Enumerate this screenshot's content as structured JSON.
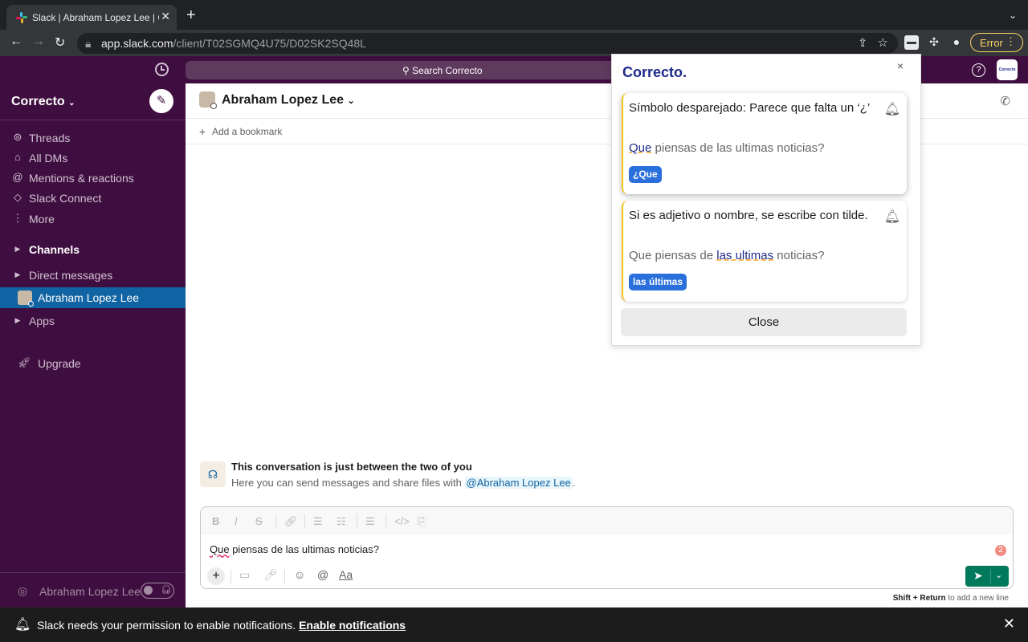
{
  "browser": {
    "tab_title": "Slack | Abraham Lopez Lee | Correcto",
    "tab_close": "✕",
    "new_tab": "+",
    "url_host": "app.slack.com",
    "url_path": "/client/T02SGMQ4U75/D02SK2SQ48L",
    "error_label": "Error"
  },
  "slack_top": {
    "search_placeholder": "Search Correcto",
    "help": "?",
    "workspace_avatar_text": "Correcto"
  },
  "sidebar": {
    "workspace": "Correcto",
    "items": [
      {
        "label": "Threads",
        "icon": "threads-icon"
      },
      {
        "label": "All DMs",
        "icon": "dms-icon"
      },
      {
        "label": "Mentions & reactions",
        "icon": "mention-icon"
      },
      {
        "label": "Slack Connect",
        "icon": "connect-icon"
      },
      {
        "label": "More",
        "icon": "more-icon"
      },
      {
        "label": "Channels",
        "icon": "caret-icon"
      },
      {
        "label": "Direct messages",
        "icon": "caret-icon"
      },
      {
        "label": "Apps",
        "icon": "caret-icon"
      },
      {
        "label": "Upgrade",
        "icon": "rocket-icon"
      }
    ],
    "active_dm": "Abraham Lopez Lee",
    "footer_user": "Abraham Lopez Lee"
  },
  "channel": {
    "name": "Abraham Lopez Lee",
    "add_bookmark": "Add a bookmark",
    "intro_title": "This conversation is just between the two of you",
    "intro_text": "Here you can send messages and share files with ",
    "intro_mention": "@Abraham Lopez Lee",
    "intro_end": "."
  },
  "composer": {
    "message_err": "Que",
    "message_rest": " piensas de las ultimas noticias?",
    "error_count": "2",
    "hint_keys": "Shift + Return",
    "hint_text": " to add a new line"
  },
  "notification": {
    "text": "Slack needs your permission to enable notifications. ",
    "link": "Enable notifications"
  },
  "correcto": {
    "logo": "Correcto.",
    "close_x": "×",
    "cards": [
      {
        "title": "Símbolo desparejado: Parece que falta un ‘¿’",
        "sentence_pre": "",
        "sentence_hl": "Que",
        "sentence_post": " piensas de las ultimas noticias?",
        "suggestion": "¿Que"
      },
      {
        "title": "Si es adjetivo o nombre, se escribe con tilde.",
        "sentence_pre": "Que piensas de ",
        "sentence_hl": "las ultimas",
        "sentence_post": " noticias?",
        "suggestion": "las últimas"
      }
    ],
    "close_button": "Close"
  },
  "colors": {
    "slack_aubergine": "#3f0e40",
    "active_blue": "#1164a3",
    "send_green": "#007a5a",
    "correcto_navy": "#1d2a8b",
    "chip_blue": "#2a6fdb"
  }
}
